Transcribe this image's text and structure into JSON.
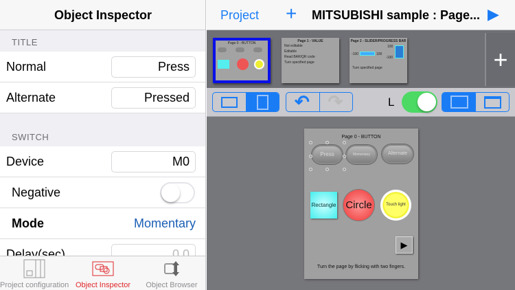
{
  "inspector": {
    "title": "Object Inspector",
    "sections": [
      {
        "header": "TITLE"
      },
      {
        "header": "SWITCH"
      }
    ],
    "normal": {
      "label": "Normal",
      "value": "Press"
    },
    "alternate": {
      "label": "Alternate",
      "value": "Pressed"
    },
    "device": {
      "label": "Device",
      "value": "M0"
    },
    "negative": {
      "label": "Negative",
      "on": false
    },
    "mode": {
      "label": "Mode",
      "value": "Momentary"
    },
    "delay": {
      "label": "Delay(sec)",
      "value": "0.0"
    }
  },
  "tabs": [
    {
      "label": "Project configuration"
    },
    {
      "label": "Object Inspector",
      "active": true
    },
    {
      "label": "Object Browser"
    }
  ],
  "header": {
    "back": "Project",
    "add": "+",
    "title": "MITSUBISHI sample : Page...",
    "play": "▶"
  },
  "thumbnails": [
    {
      "title": "Page 0 - BUTTON",
      "selected": true
    },
    {
      "title": "Page 1 - VALUE",
      "rows": [
        "Not editable",
        "Editable",
        "Read BAR/QR code",
        "Turn specified page"
      ]
    },
    {
      "title": "Page 2 - SLIDER/PROGRESS BAR",
      "labels": [
        "-100",
        "100",
        "100",
        "-100",
        "Turn specified page"
      ]
    }
  ],
  "add_page": "+",
  "toolbar": {
    "layer_label": "L",
    "layer_on": true
  },
  "page": {
    "title": "Page 0 - BUTTON",
    "buttons": [
      "Press",
      "Momentary",
      "Alternate"
    ],
    "rectangle": "Rectangle",
    "circle": "Circle",
    "touch_light": "Touch light",
    "next": "▶",
    "footer": "Turn the page by flicking with two fingers."
  },
  "colors": {
    "accent": "#1a7cf5",
    "active_tab": "#e0272b",
    "toggle_on": "#4cd964"
  }
}
